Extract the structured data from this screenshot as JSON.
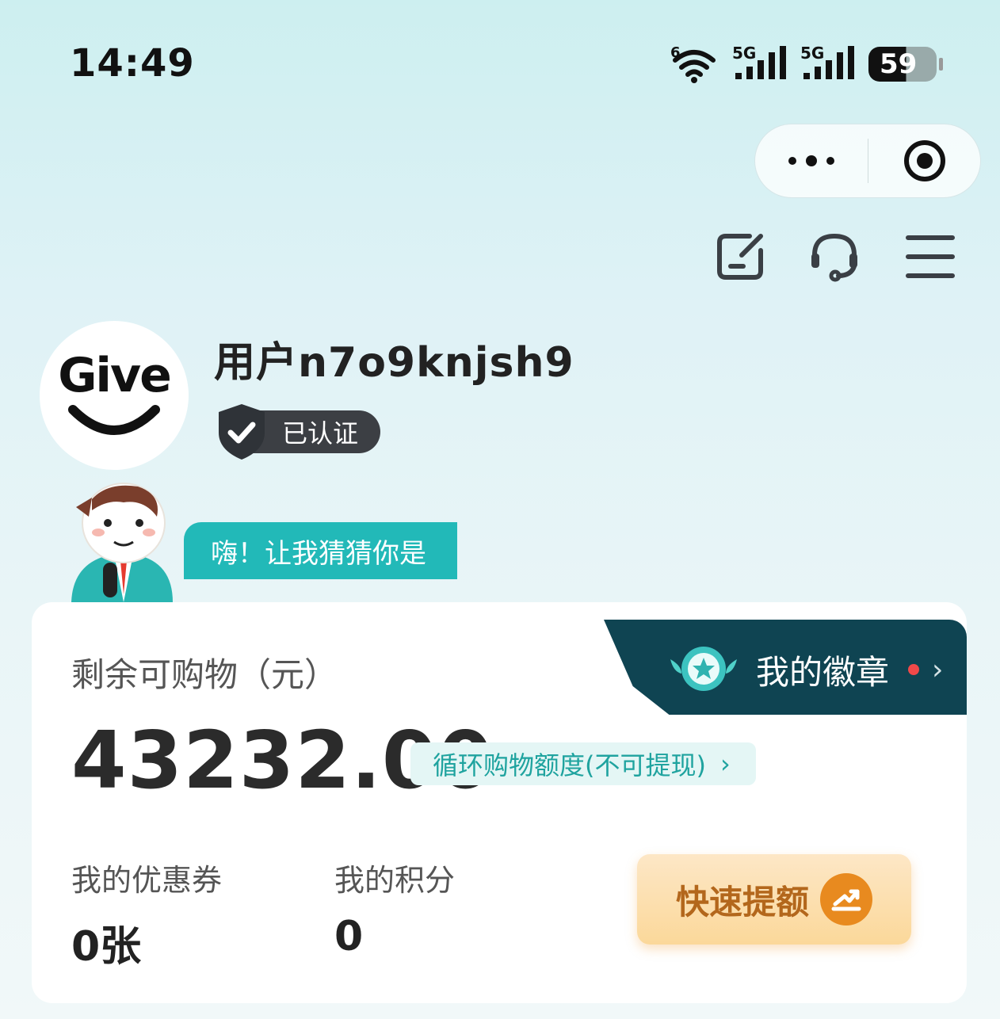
{
  "status_bar": {
    "time": "14:49",
    "wifi_label": "6",
    "signal1_label": "5G",
    "signal2_label": "5G",
    "battery": "59"
  },
  "capsule": {
    "more_icon": "more-dots-icon",
    "close_icon": "target-close-icon"
  },
  "toolbar": {
    "icons": [
      "edit-note-icon",
      "headset-icon",
      "menu-icon"
    ]
  },
  "profile": {
    "avatar_text": "Give",
    "username": "用户n7o9knjsh9",
    "verified_label": "已认证"
  },
  "mascot": {
    "speech": "嗨！让我猜猜你是"
  },
  "badges": {
    "label": "我的徽章"
  },
  "balance": {
    "label": "剩余可购物（元）",
    "value": "43232.00",
    "quota_tag": "循环购物额度(不可提现)"
  },
  "stats": {
    "coupon_label": "我的优惠券",
    "coupon_value": "0张",
    "points_label": "我的积分",
    "points_value": "0"
  },
  "boost": {
    "label": "快速提额"
  },
  "colors": {
    "accent_teal": "#22b9b8",
    "badge_bg": "#0f4452",
    "boost_orange": "#e88a1f"
  }
}
